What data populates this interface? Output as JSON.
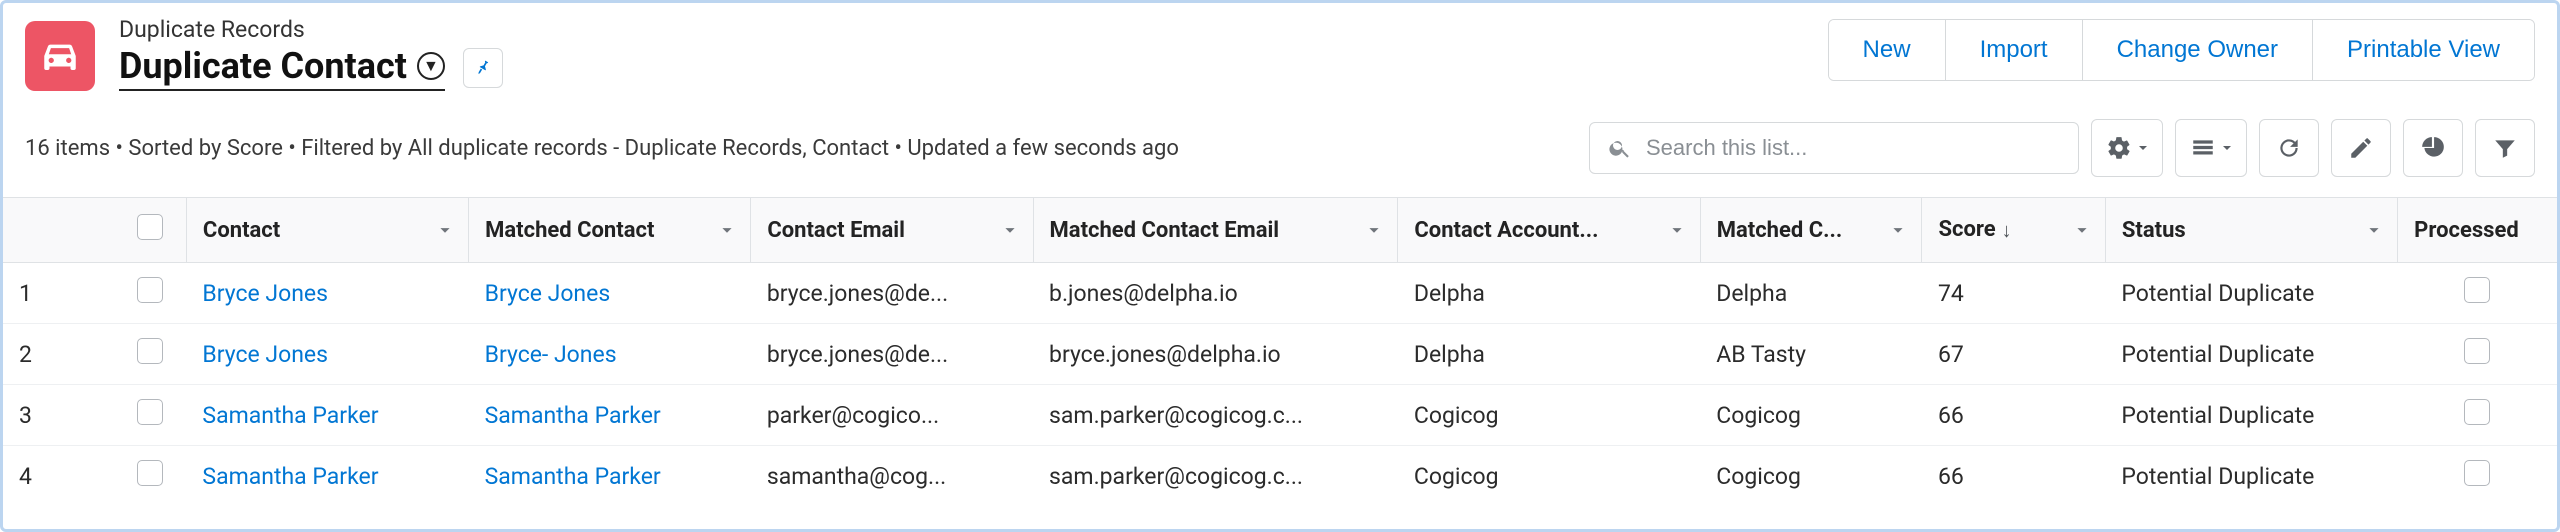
{
  "header": {
    "breadcrumb": "Duplicate Records",
    "title": "Duplicate Contact"
  },
  "actions": {
    "new": "New",
    "import": "Import",
    "change_owner": "Change Owner",
    "printable_view": "Printable View"
  },
  "subhead": "16 items • Sorted by Score • Filtered by All duplicate records - Duplicate Records, Contact • Updated a few seconds ago",
  "search": {
    "placeholder": "Search this list..."
  },
  "columns": {
    "contact": "Contact",
    "matched_contact": "Matched Contact",
    "contact_email": "Contact Email",
    "matched_contact_email": "Matched Contact Email",
    "contact_account": "Contact Account...",
    "matched_c": "Matched C...",
    "score": "Score",
    "status": "Status",
    "processed": "Processed"
  },
  "rows": [
    {
      "n": "1",
      "contact": "Bryce Jones",
      "matched": "Bryce Jones",
      "email": "bryce.jones@de...",
      "memail": "b.jones@delpha.io",
      "acct": "Delpha",
      "macct": "Delpha",
      "score": "74",
      "status": "Potential Duplicate"
    },
    {
      "n": "2",
      "contact": "Bryce Jones",
      "matched": "Bryce- Jones",
      "email": "bryce.jones@de...",
      "memail": "bryce.jones@delpha.io",
      "acct": "Delpha",
      "macct": "AB Tasty",
      "score": "67",
      "status": "Potential Duplicate"
    },
    {
      "n": "3",
      "contact": "Samantha Parker",
      "matched": "Samantha Parker",
      "email": "parker@cogico...",
      "memail": "sam.parker@cogicog.c...",
      "acct": "Cogicog",
      "macct": "Cogicog",
      "score": "66",
      "status": "Potential Duplicate"
    },
    {
      "n": "4",
      "contact": "Samantha Parker",
      "matched": "Samantha Parker",
      "email": "samantha@cog...",
      "memail": "sam.parker@cogicog.c...",
      "acct": "Cogicog",
      "macct": "Cogicog",
      "score": "66",
      "status": "Potential Duplicate"
    }
  ]
}
